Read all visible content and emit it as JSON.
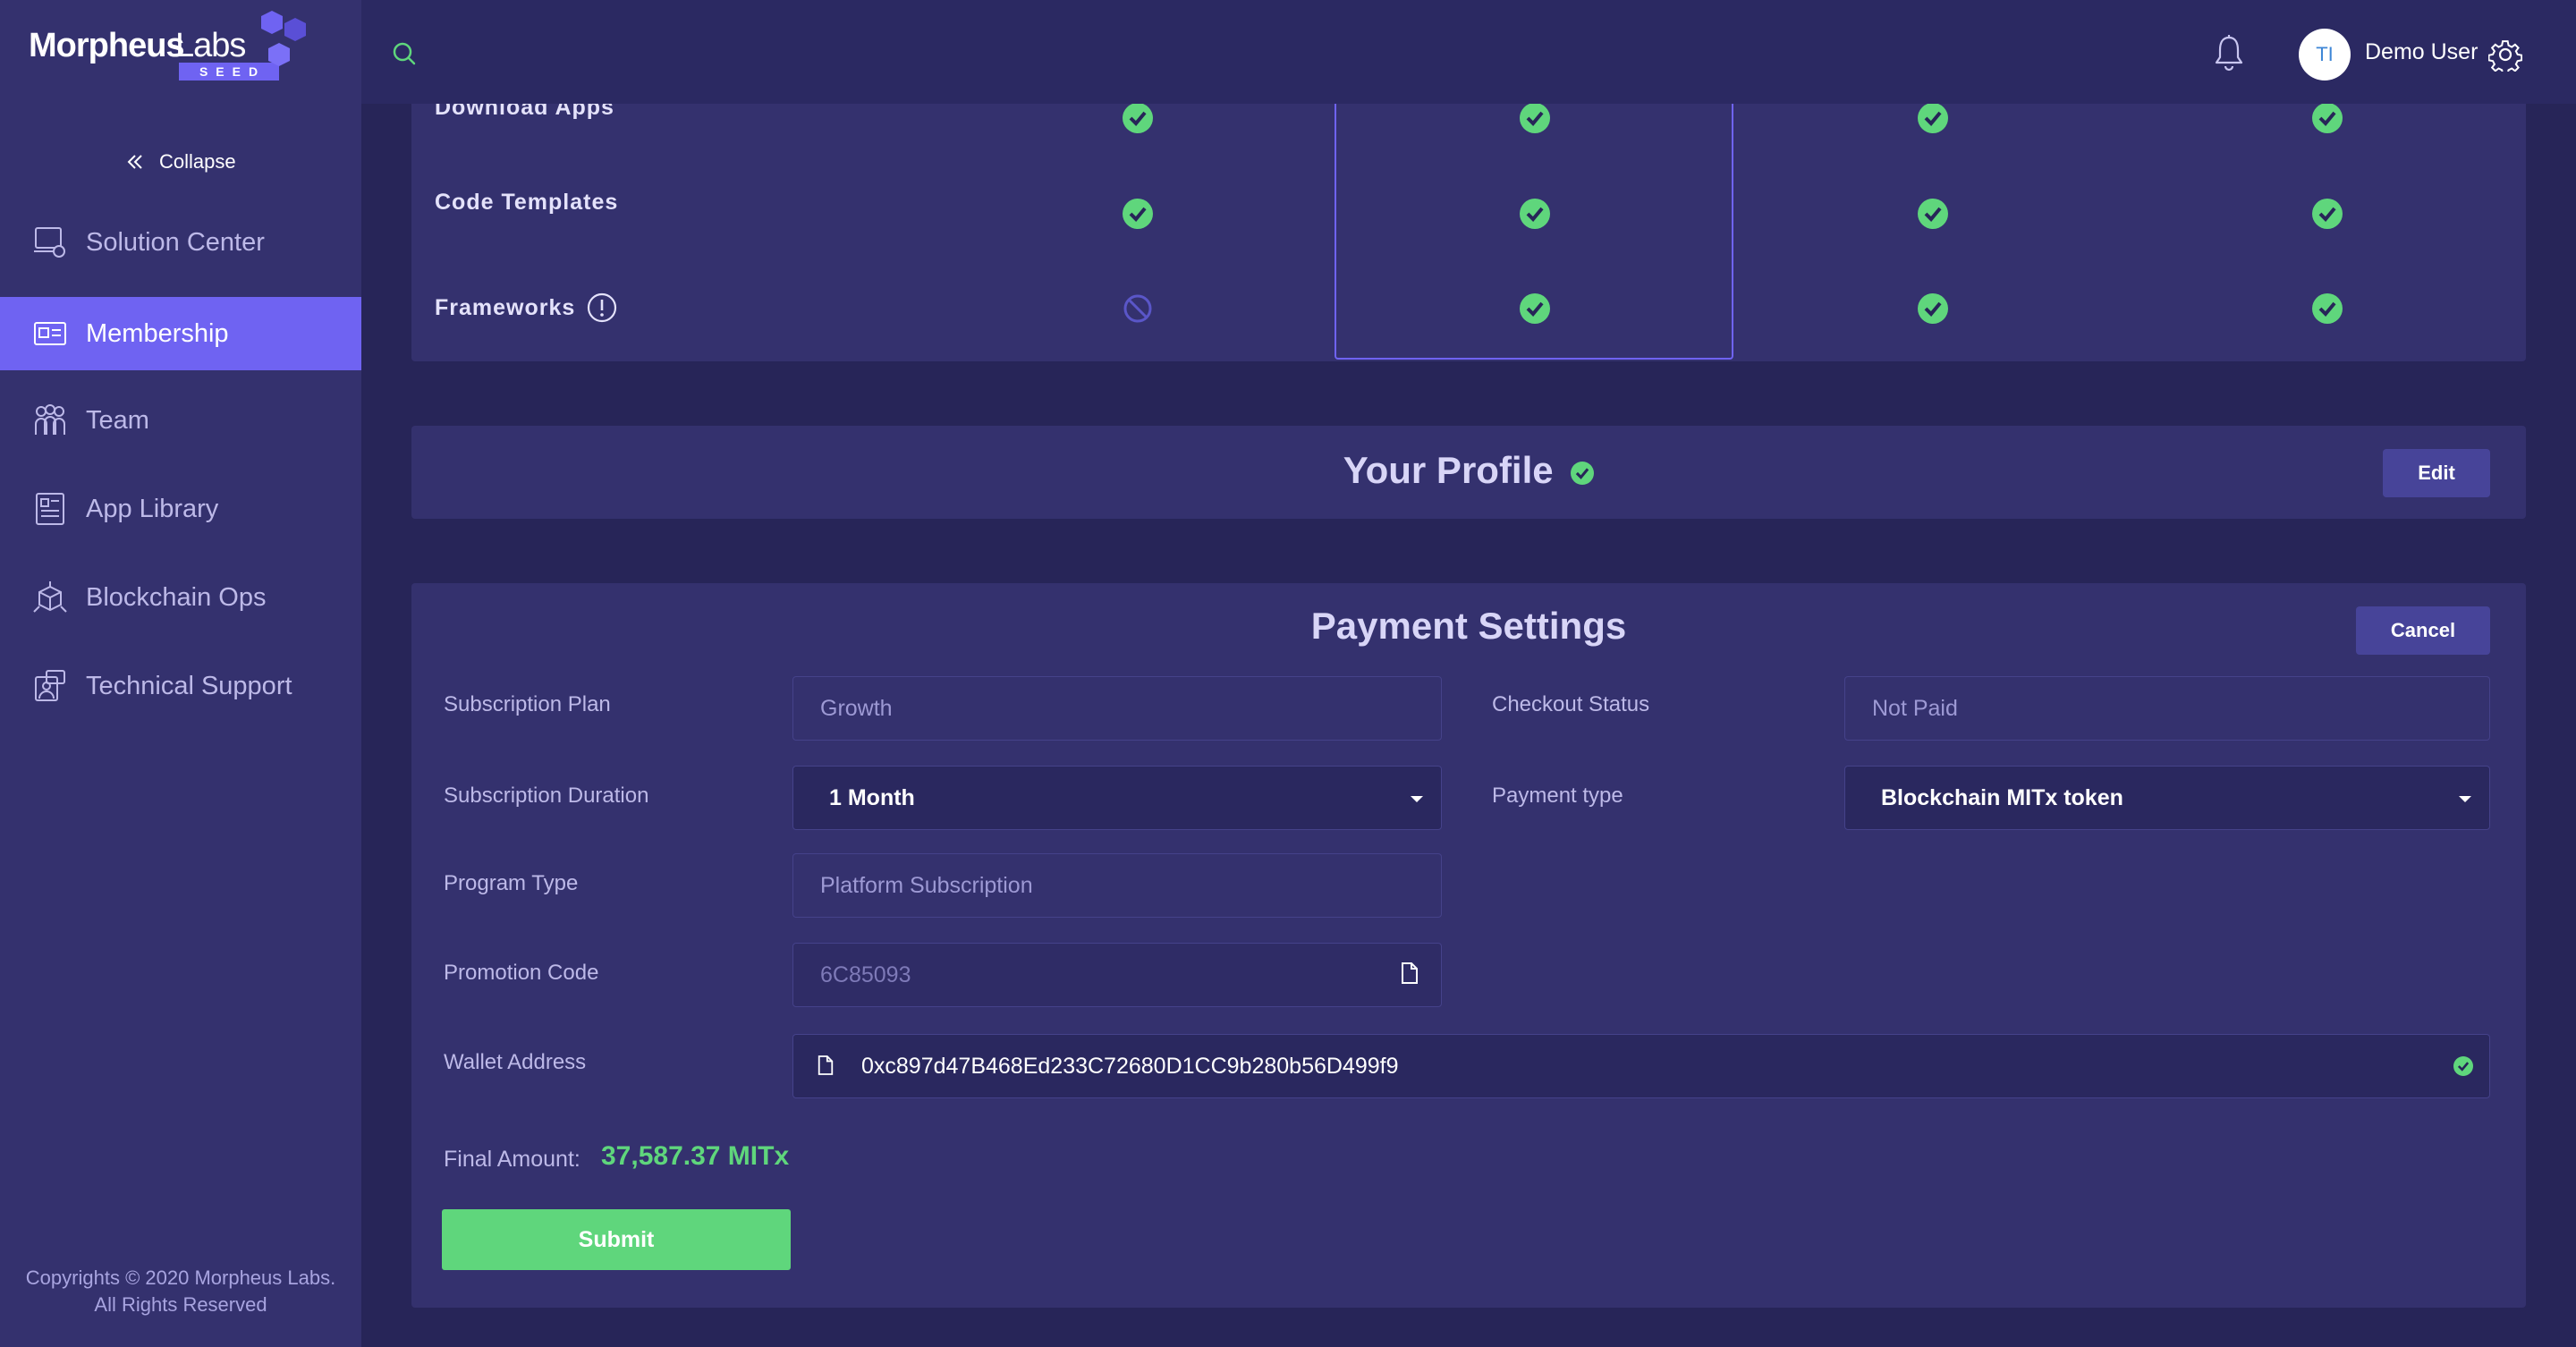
{
  "logo": {
    "word1": "Morpheus",
    "word2": "Labs",
    "tag": "SEED"
  },
  "sidebar": {
    "collapse_label": "Collapse",
    "items": [
      {
        "label": "Solution Center",
        "icon": "solution-center-icon"
      },
      {
        "label": "Membership",
        "icon": "membership-icon",
        "active": true
      },
      {
        "label": "Team",
        "icon": "team-icon"
      },
      {
        "label": "App Library",
        "icon": "app-library-icon"
      },
      {
        "label": "Blockchain Ops",
        "icon": "blockchain-ops-icon"
      },
      {
        "label": "Technical Support",
        "icon": "technical-support-icon"
      }
    ],
    "copyright_line1": "Copyrights © 2020 Morpheus Labs.",
    "copyright_line2": "All Rights Reserved"
  },
  "header": {
    "avatar_initials": "TI",
    "username": "Demo User"
  },
  "features": {
    "rows": [
      {
        "label": "Download Apps",
        "cells": [
          "check",
          "check",
          "check",
          "check"
        ]
      },
      {
        "label": "Code Templates",
        "cells": [
          "check",
          "check",
          "check",
          "check"
        ]
      },
      {
        "label": "Frameworks",
        "cells": [
          "blocked",
          "check",
          "check",
          "check"
        ],
        "info": true
      }
    ]
  },
  "profile": {
    "title": "Your Profile",
    "edit_label": "Edit"
  },
  "payment": {
    "title": "Payment Settings",
    "cancel_label": "Cancel",
    "subscription_plan_label": "Subscription Plan",
    "subscription_plan_value": "Growth",
    "checkout_status_label": "Checkout Status",
    "checkout_status_value": "Not Paid",
    "subscription_duration_label": "Subscription Duration",
    "subscription_duration_value": "1 Month",
    "payment_type_label": "Payment type",
    "payment_type_value": "Blockchain MITx token",
    "program_type_label": "Program Type",
    "program_type_value": "Platform Subscription",
    "promotion_code_label": "Promotion Code",
    "promotion_code_value": "6C85093",
    "wallet_address_label": "Wallet Address",
    "wallet_address_value": "0xc897d47B468Ed233C72680D1CC9b280b56D499f9",
    "final_amount_label": "Final Amount:",
    "final_amount_value": "37,587.37 MITx",
    "submit_label": "Submit"
  },
  "colors": {
    "accent": "#6f63f2",
    "success": "#5fd67c",
    "background": "#272558",
    "panel": "#34316e"
  }
}
